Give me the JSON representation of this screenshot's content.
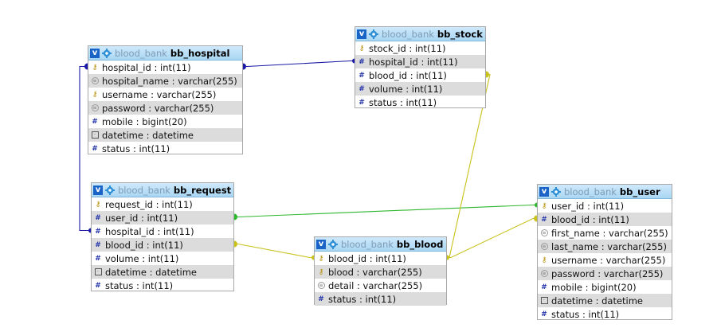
{
  "db_label": "blood_bank",
  "toggle_label": "v",
  "tables": {
    "bb_hospital": {
      "name": "bb_hospital",
      "columns": [
        {
          "text": "hospital_id : int(11)",
          "icon": "key-icon"
        },
        {
          "text": "hospital_name : varchar(255)",
          "icon": "string-icon"
        },
        {
          "text": "username : varchar(255)",
          "icon": "key-icon"
        },
        {
          "text": "password : varchar(255)",
          "icon": "string-icon"
        },
        {
          "text": "mobile : bigint(20)",
          "icon": "number-icon"
        },
        {
          "text": "datetime : datetime",
          "icon": "date-icon"
        },
        {
          "text": "status : int(11)",
          "icon": "number-icon"
        }
      ]
    },
    "bb_stock": {
      "name": "bb_stock",
      "columns": [
        {
          "text": "stock_id : int(11)",
          "icon": "key-icon"
        },
        {
          "text": "hospital_id : int(11)",
          "icon": "number-icon"
        },
        {
          "text": "blood_id : int(11)",
          "icon": "number-icon"
        },
        {
          "text": "volume : int(11)",
          "icon": "number-icon"
        },
        {
          "text": "status : int(11)",
          "icon": "number-icon"
        }
      ]
    },
    "bb_request": {
      "name": "bb_request",
      "columns": [
        {
          "text": "request_id : int(11)",
          "icon": "key-icon"
        },
        {
          "text": "user_id : int(11)",
          "icon": "number-icon"
        },
        {
          "text": "hospital_id : int(11)",
          "icon": "number-icon"
        },
        {
          "text": "blood_id : int(11)",
          "icon": "number-icon"
        },
        {
          "text": "volume : int(11)",
          "icon": "number-icon"
        },
        {
          "text": "datetime : datetime",
          "icon": "date-icon"
        },
        {
          "text": "status : int(11)",
          "icon": "number-icon"
        }
      ]
    },
    "bb_blood": {
      "name": "bb_blood",
      "columns": [
        {
          "text": "blood_id : int(11)",
          "icon": "key-icon"
        },
        {
          "text": "blood : varchar(255)",
          "icon": "key-icon"
        },
        {
          "text": "detail : varchar(255)",
          "icon": "string-icon"
        },
        {
          "text": "status : int(11)",
          "icon": "number-icon"
        }
      ]
    },
    "bb_user": {
      "name": "bb_user",
      "columns": [
        {
          "text": "user_id : int(11)",
          "icon": "key-icon"
        },
        {
          "text": "blood_id : int(11)",
          "icon": "number-icon"
        },
        {
          "text": "first_name : varchar(255)",
          "icon": "string-icon"
        },
        {
          "text": "last_name : varchar(255)",
          "icon": "string-icon"
        },
        {
          "text": "username : varchar(255)",
          "icon": "key-icon"
        },
        {
          "text": "password : varchar(255)",
          "icon": "string-icon"
        },
        {
          "text": "mobile : bigint(20)",
          "icon": "number-icon"
        },
        {
          "text": "datetime : datetime",
          "icon": "date-icon"
        },
        {
          "text": "status : int(11)",
          "icon": "number-icon"
        }
      ]
    }
  },
  "relations": [
    {
      "from": "bb_hospital.hospital_id",
      "to": "bb_stock.hospital_id",
      "color": "#1a1aa6"
    },
    {
      "from": "bb_hospital.hospital_id",
      "to": "bb_request.hospital_id",
      "color": "#1a1aa6"
    },
    {
      "from": "bb_request.user_id",
      "to": "bb_user.user_id",
      "color": "#2db82d"
    },
    {
      "from": "bb_request.blood_id",
      "to": "bb_blood.blood_id",
      "color": "#c8c21a"
    },
    {
      "from": "bb_stock.blood_id",
      "to": "bb_blood.blood_id",
      "color": "#c8c21a"
    },
    {
      "from": "bb_user.blood_id",
      "to": "bb_blood.blood_id",
      "color": "#c8c21a"
    }
  ]
}
